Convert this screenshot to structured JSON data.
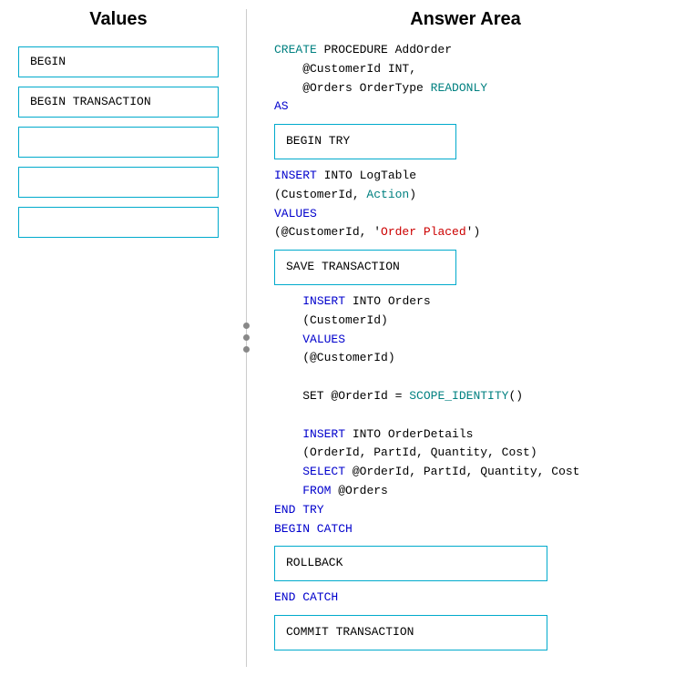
{
  "left_panel": {
    "title": "Values",
    "items": [
      {
        "id": "item-begin",
        "text": "BEGIN",
        "empty": false
      },
      {
        "id": "item-begin-transaction",
        "text": "BEGIN TRANSACTION",
        "empty": false
      },
      {
        "id": "item-empty1",
        "text": "",
        "empty": true
      },
      {
        "id": "item-empty2",
        "text": "",
        "empty": true
      },
      {
        "id": "item-empty3",
        "text": "",
        "empty": true
      }
    ]
  },
  "right_panel": {
    "title": "Answer Area",
    "code_blocks": [
      {
        "id": "line1",
        "segments": [
          {
            "text": "CREATE",
            "class": "kw-teal"
          },
          {
            "text": " PROCEDURE AddOrder",
            "class": "text-black"
          }
        ]
      },
      {
        "id": "line2",
        "segments": [
          {
            "text": "    @CustomerId INT,",
            "class": "text-black"
          }
        ]
      },
      {
        "id": "line3",
        "segments": [
          {
            "text": "    @Orders OrderType ",
            "class": "text-black"
          },
          {
            "text": "READONLY",
            "class": "kw-teal"
          }
        ]
      },
      {
        "id": "line4",
        "segments": [
          {
            "text": "AS",
            "class": "kw-blue"
          }
        ]
      },
      {
        "id": "box1",
        "type": "box",
        "text": "BEGIN TRY"
      },
      {
        "id": "line5",
        "segments": [
          {
            "text": "INSERT",
            "class": "kw-blue"
          },
          {
            "text": " INTO LogTable",
            "class": "text-black"
          }
        ]
      },
      {
        "id": "line6",
        "segments": [
          {
            "text": "(CustomerId, ",
            "class": "text-black"
          },
          {
            "text": "Action",
            "class": "kw-teal"
          },
          {
            "text": ")",
            "class": "text-black"
          }
        ]
      },
      {
        "id": "line7",
        "segments": [
          {
            "text": "VALUES",
            "class": "kw-blue"
          }
        ]
      },
      {
        "id": "line8",
        "segments": [
          {
            "text": "(@CustomerId, '",
            "class": "text-black"
          },
          {
            "text": "Order Placed",
            "class": "kw-red"
          },
          {
            "text": "')",
            "class": "text-black"
          }
        ]
      },
      {
        "id": "box2",
        "type": "box",
        "text": "SAVE TRANSACTION"
      },
      {
        "id": "line9",
        "segments": [
          {
            "text": "    ",
            "class": "text-black"
          },
          {
            "text": "INSERT",
            "class": "kw-blue"
          },
          {
            "text": " INTO Orders",
            "class": "text-black"
          }
        ]
      },
      {
        "id": "line10",
        "segments": [
          {
            "text": "    (CustomerId)",
            "class": "text-black"
          }
        ]
      },
      {
        "id": "line11",
        "segments": [
          {
            "text": "    ",
            "class": "text-black"
          },
          {
            "text": "VALUES",
            "class": "kw-blue"
          }
        ]
      },
      {
        "id": "line12",
        "segments": [
          {
            "text": "    (@CustomerId)",
            "class": "text-black"
          }
        ]
      },
      {
        "id": "line_blank1",
        "segments": [
          {
            "text": "",
            "class": "text-black"
          }
        ]
      },
      {
        "id": "line13",
        "segments": [
          {
            "text": "    SET @OrderId = ",
            "class": "text-black"
          },
          {
            "text": "SCOPE_IDENTITY",
            "class": "kw-teal"
          },
          {
            "text": "()",
            "class": "text-black"
          }
        ]
      },
      {
        "id": "line_blank2",
        "segments": [
          {
            "text": "",
            "class": "text-black"
          }
        ]
      },
      {
        "id": "line14",
        "segments": [
          {
            "text": "    ",
            "class": "text-black"
          },
          {
            "text": "INSERT",
            "class": "kw-blue"
          },
          {
            "text": " INTO OrderDetails",
            "class": "text-black"
          }
        ]
      },
      {
        "id": "line15",
        "segments": [
          {
            "text": "    (OrderId, PartId, Quantity, Cost)",
            "class": "text-black"
          }
        ]
      },
      {
        "id": "line16",
        "segments": [
          {
            "text": "    ",
            "class": "text-black"
          },
          {
            "text": "SELECT",
            "class": "kw-blue"
          },
          {
            "text": " @OrderId, PartId, Quantity, Cost",
            "class": "text-black"
          }
        ]
      },
      {
        "id": "line17",
        "segments": [
          {
            "text": "    ",
            "class": "text-black"
          },
          {
            "text": "FROM",
            "class": "kw-blue"
          },
          {
            "text": " @Orders",
            "class": "text-black"
          }
        ]
      },
      {
        "id": "line18",
        "segments": [
          {
            "text": "END TRY",
            "class": "kw-blue"
          }
        ]
      },
      {
        "id": "line19",
        "segments": [
          {
            "text": "BEGIN CATCH",
            "class": "kw-blue"
          }
        ]
      },
      {
        "id": "box3",
        "type": "box",
        "text": "ROLLBACK"
      },
      {
        "id": "line20",
        "segments": [
          {
            "text": "END CATCH",
            "class": "kw-blue"
          }
        ]
      },
      {
        "id": "box4",
        "type": "box",
        "text": "COMMIT TRANSACTION"
      }
    ]
  }
}
